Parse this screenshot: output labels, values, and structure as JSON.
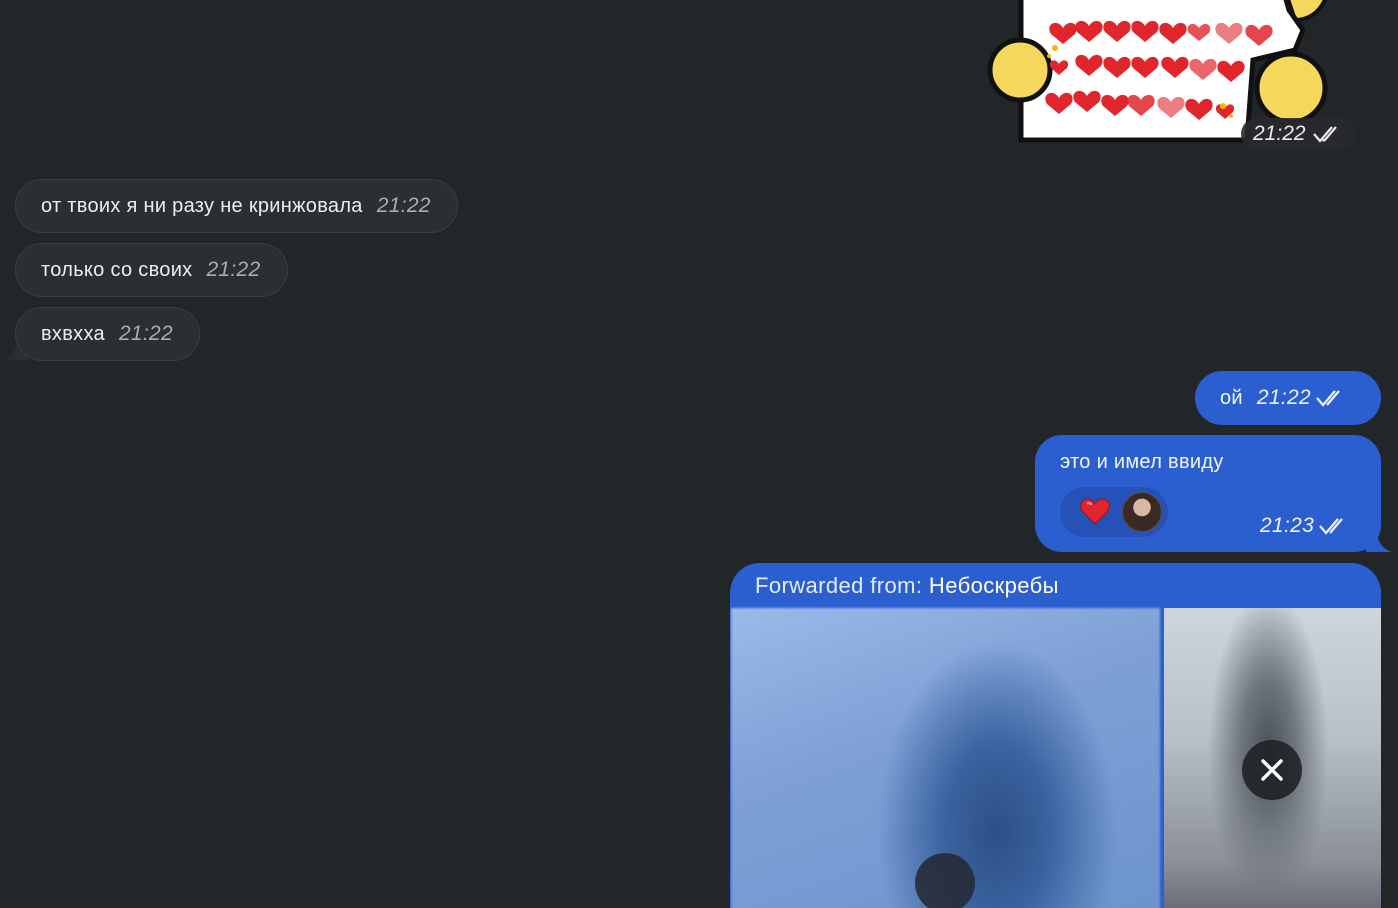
{
  "sticker": {
    "time": "21:22",
    "status_icon": "double-check-icon"
  },
  "incoming": [
    {
      "text": "от твоих я ни разу не кринжовала",
      "time": "21:22"
    },
    {
      "text": "только со своих",
      "time": "21:22"
    },
    {
      "text": "вхвхха",
      "time": "21:22"
    }
  ],
  "outgoing": [
    {
      "text": "ой",
      "time": "21:22",
      "status_icon": "double-check-icon"
    },
    {
      "text": "это и имел ввиду",
      "time": "21:23",
      "status_icon": "double-check-icon",
      "reaction": {
        "emoji": "heart-icon",
        "by": "avatar"
      }
    }
  ],
  "forwarded": {
    "label": "Forwarded from:",
    "source": "Небоскребы"
  },
  "colors": {
    "background": "#232628",
    "incoming_bubble": "#2c2f32",
    "outgoing_bubble": "#2b5fcf",
    "heart": "#e0262c"
  }
}
